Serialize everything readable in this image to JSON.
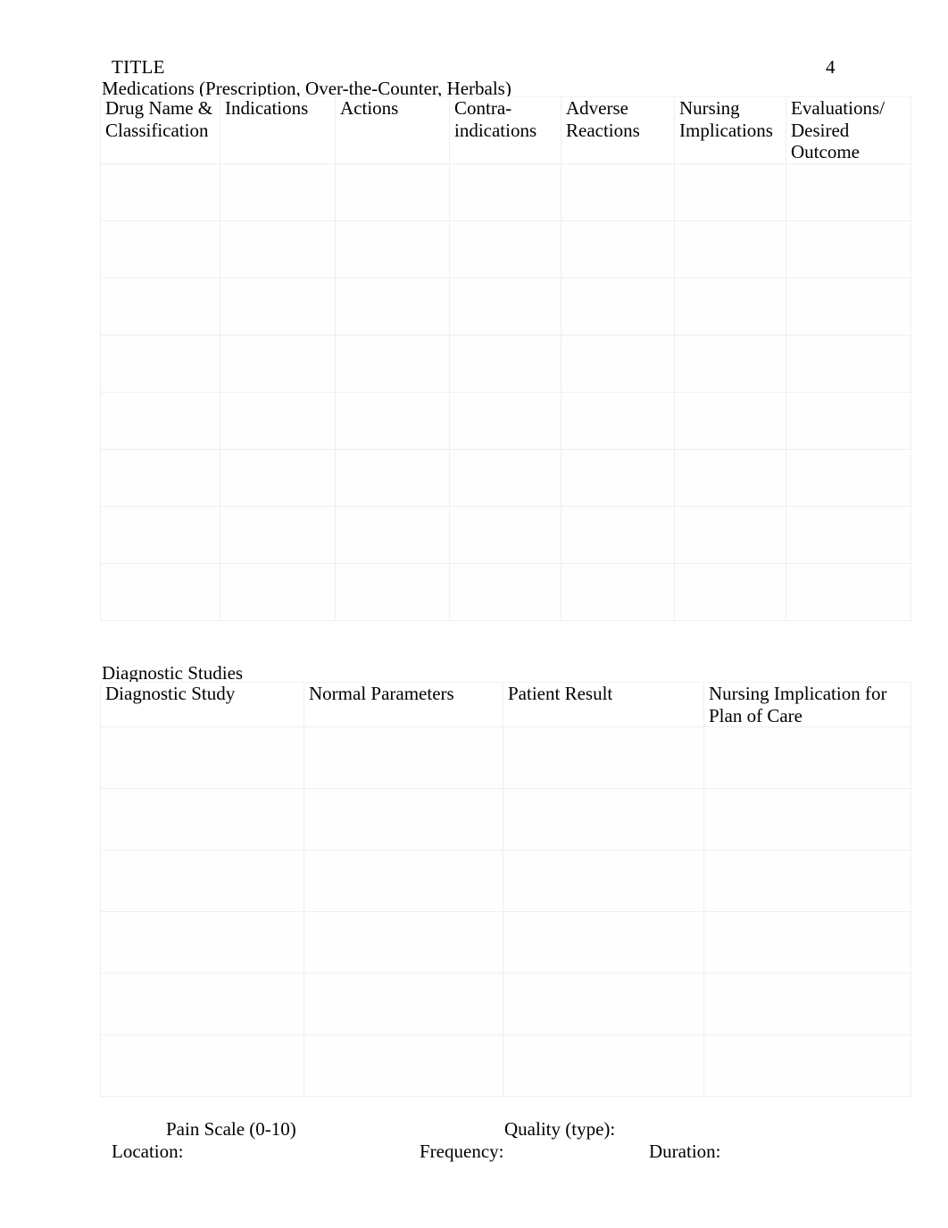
{
  "document": {
    "title": "TITLE",
    "page_number": "4"
  },
  "medications_section": {
    "label": "Medications (Prescription, Over-the-Counter, Herbals)",
    "columns": [
      "Drug Name & Classification",
      "Indications",
      "Actions",
      "Contra-indications",
      "Adverse Reactions",
      "Nursing Implications",
      "Evaluations/ Desired Outcome"
    ],
    "rows": [
      [
        "",
        "",
        "",
        "",
        "",
        "",
        ""
      ],
      [
        "",
        "",
        "",
        "",
        "",
        "",
        ""
      ],
      [
        "",
        "",
        "",
        "",
        "",
        "",
        ""
      ],
      [
        "",
        "",
        "",
        "",
        "",
        "",
        ""
      ],
      [
        "",
        "",
        "",
        "",
        "",
        "",
        ""
      ],
      [
        "",
        "",
        "",
        "",
        "",
        "",
        ""
      ],
      [
        "",
        "",
        "",
        "",
        "",
        "",
        ""
      ],
      [
        "",
        "",
        "",
        "",
        "",
        "",
        ""
      ]
    ]
  },
  "diagnostic_section": {
    "label": "Diagnostic Studies",
    "columns": [
      "Diagnostic Study",
      "Normal Parameters",
      "Patient Result",
      "Nursing Implication for Plan of Care"
    ],
    "rows": [
      [
        "",
        "",
        "",
        ""
      ],
      [
        "",
        "",
        "",
        ""
      ],
      [
        "",
        "",
        "",
        ""
      ],
      [
        "",
        "",
        "",
        ""
      ],
      [
        "",
        "",
        "",
        ""
      ],
      [
        "",
        "",
        "",
        ""
      ]
    ]
  },
  "pain_assessment": {
    "scale_label": "Pain Scale (0-10)",
    "quality_label": "Quality (type):",
    "location_label": "Location:",
    "frequency_label": "Frequency:",
    "duration_label": "Duration:"
  },
  "style": {
    "border_color": "#efefef",
    "text_color": "#000000",
    "page_background": "#ffffff"
  }
}
